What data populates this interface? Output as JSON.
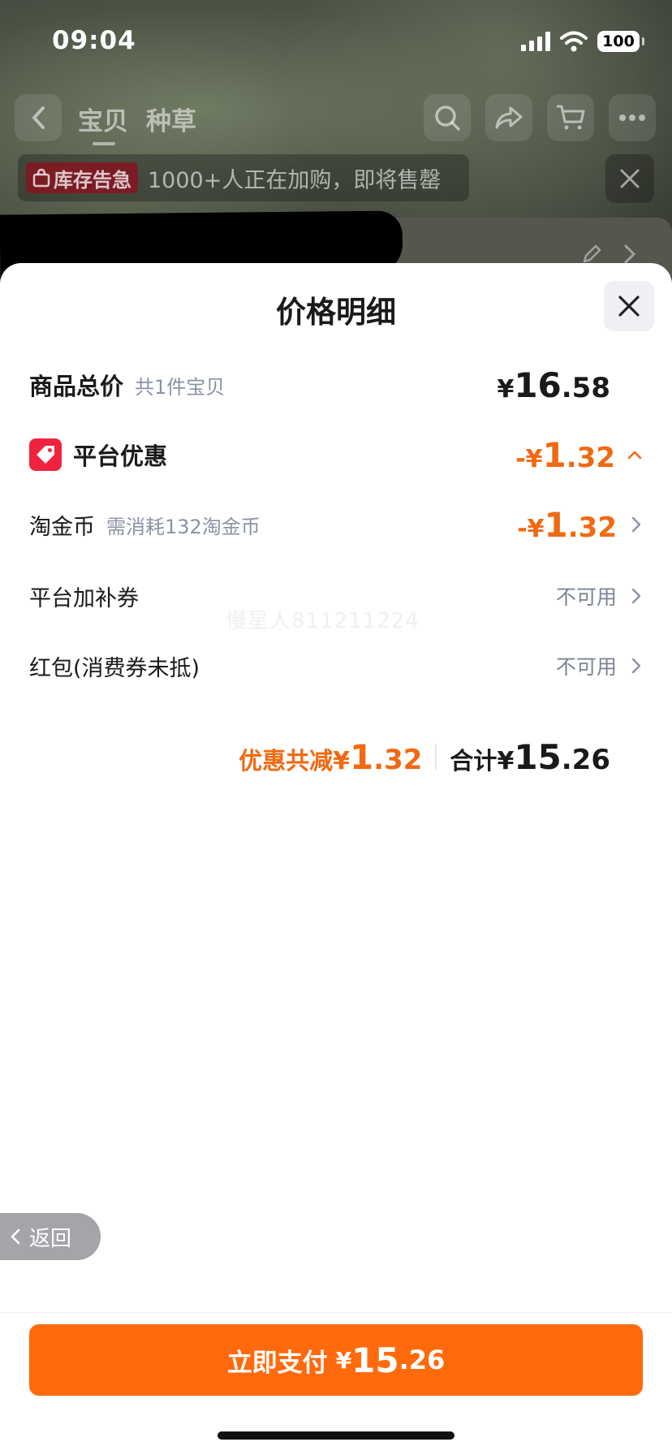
{
  "status_bar": {
    "time": "09:04",
    "battery": "100"
  },
  "background": {
    "tabs": [
      {
        "label": "宝贝"
      },
      {
        "label": "种草"
      }
    ],
    "stock_badge": "库存告急",
    "stock_text": "1000+人正在加购，即将售罄"
  },
  "sheet": {
    "title": "价格明细",
    "rows": {
      "total": {
        "label": "商品总价",
        "sub": "共1件宝贝",
        "currency": "¥",
        "int": "16",
        "dec": ".58"
      },
      "platform": {
        "label": "平台优惠",
        "prefix": "-¥",
        "int": "1",
        "dec": ".32"
      },
      "coins": {
        "label": "淘金币",
        "sub": "需消耗132淘金币",
        "prefix": "-¥",
        "int": "1",
        "dec": ".32"
      },
      "subsidy": {
        "label": "平台加补券",
        "status": "不可用"
      },
      "redpacket": {
        "label": "红包(消费券未抵)",
        "status": "不可用"
      }
    },
    "watermark": "慢星人811211224",
    "summary": {
      "save_label": "优惠共减",
      "save_currency": "¥",
      "save_int": "1",
      "save_dec": ".32",
      "total_label": "合计",
      "total_currency": "¥",
      "total_int": "15",
      "total_dec": ".26"
    }
  },
  "back_label": "返回",
  "pay_button": {
    "label": "立即支付",
    "currency": "¥",
    "int": "15",
    "dec": ".26"
  },
  "colors": {
    "accent": "#ff6a0c",
    "discount": "#f06a12",
    "tag": "#f0233f"
  }
}
